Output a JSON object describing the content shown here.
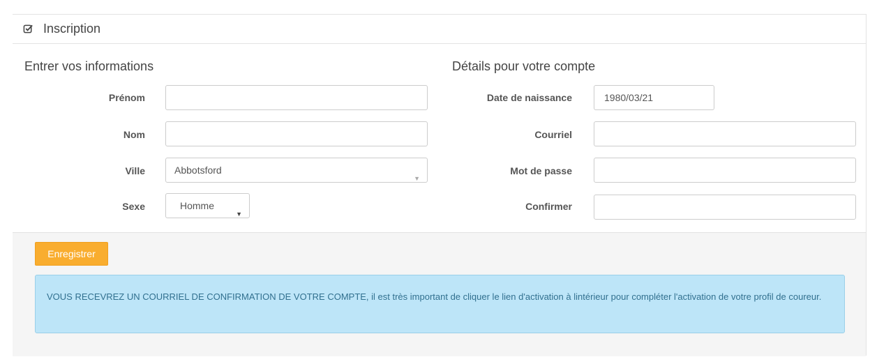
{
  "header": {
    "title": "Inscription",
    "icon": "check-square-icon",
    "accent_color": "#f7a823"
  },
  "personal": {
    "title": "Entrer vos informations",
    "first_name_label": "Prénom",
    "first_name_value": "",
    "last_name_label": "Nom",
    "last_name_value": "",
    "city_label": "Ville",
    "city_value": "Abbotsford",
    "sex_label": "Sexe",
    "sex_value": "Homme"
  },
  "account": {
    "title": "Détails pour votre compte",
    "birthdate_label": "Date de naissance",
    "birthdate_value": "1980/03/21",
    "email_label": "Courriel",
    "email_value": "",
    "password_label": "Mot de passe",
    "password_value": "",
    "confirm_label": "Confirmer",
    "confirm_value": ""
  },
  "footer": {
    "save_label": "Enregistrer",
    "notice": "VOUS RECEVREZ UN COURRIEL DE CONFIRMATION DE VOTRE COMPTE, il est très important de cliquer le lien d'activation à lintérieur pour compléter l'activation de votre profil de coureur.",
    "button_color": "#f9ad2f",
    "notice_bg": "#bde5f8"
  }
}
